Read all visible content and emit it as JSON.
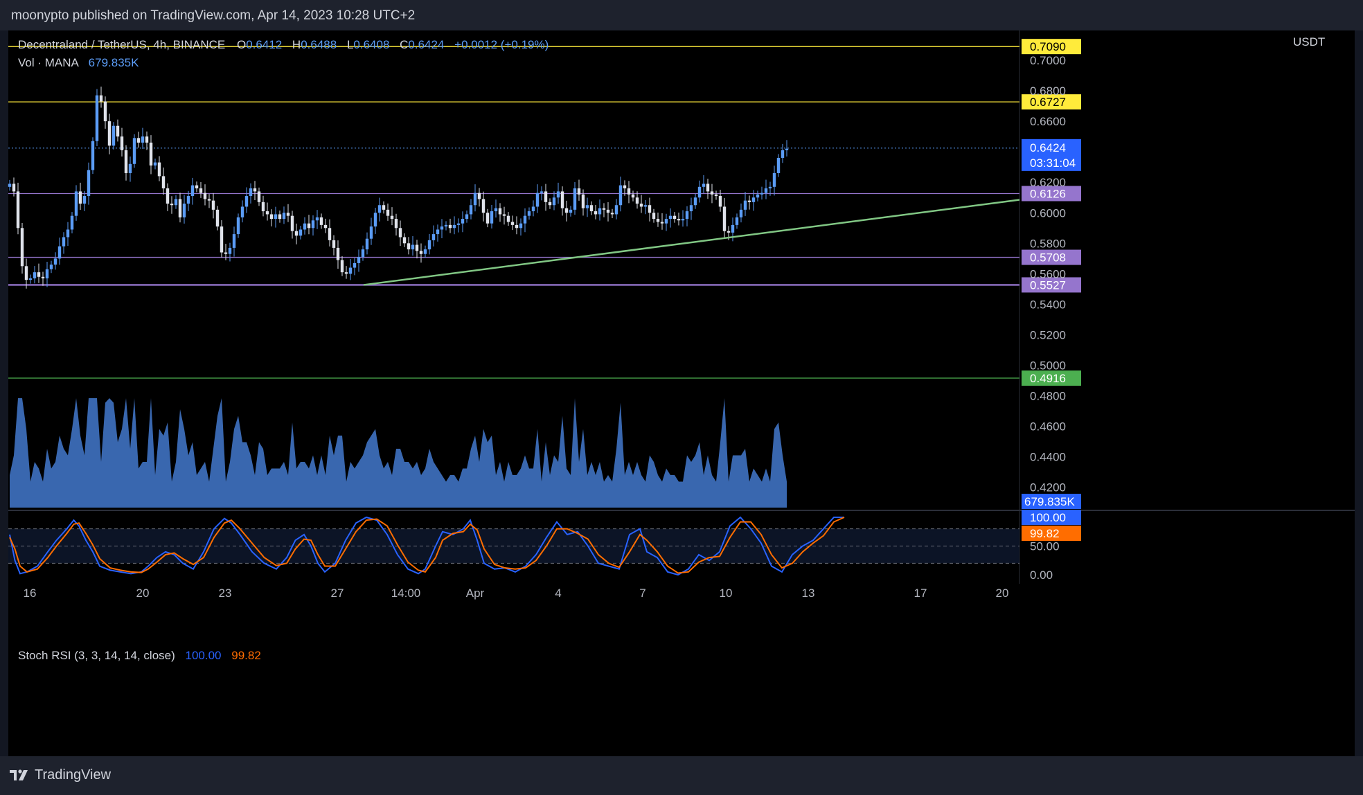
{
  "header": {
    "publish_line": "moonypto published on TradingView.com, Apr 14, 2023 10:28 UTC+2"
  },
  "legend": {
    "symbol": "Decentraland / TetherUS, 4h, BINANCE",
    "o_label": "O",
    "o": "0.6412",
    "h_label": "H",
    "h": "0.6488",
    "l_label": "L",
    "l": "0.6408",
    "c_label": "C",
    "c": "0.6424",
    "change": "+0.0012 (+0.19%)",
    "vol_label": "Vol · MANA",
    "vol_value": "679.835K",
    "stoch_label": "Stoch RSI (3, 3, 14, 14, close)",
    "stoch_k": "100.00",
    "stoch_d": "99.82"
  },
  "footer": {
    "brand": "TradingView"
  },
  "colors": {
    "up": "#5b9cf6",
    "down": "#e0e3eb",
    "yellow": "#ffeb3b",
    "purple": "#9575cd",
    "green": "#4caf50",
    "trend": "#81c784",
    "k": "#2962ff",
    "d": "#ff6d00"
  },
  "chart_data": [
    {
      "type": "candlestick",
      "title": "Decentraland / TetherUS, 4h, BINANCE",
      "y_unit": "USDT",
      "ylim": [
        0.408,
        0.712
      ],
      "y_ticks": [
        "0.7000",
        "0.6800",
        "0.6600",
        "0.6200",
        "0.6000",
        "0.5800",
        "0.5600",
        "0.5400",
        "0.5200",
        "0.5000",
        "0.4800",
        "0.4600",
        "0.4400",
        "0.4200"
      ],
      "x_ticks": [
        "16",
        "20",
        "23",
        "27",
        "14:00",
        "Apr",
        "4",
        "7",
        "10",
        "13",
        "17",
        "20"
      ],
      "last_price": "0.6424",
      "countdown": "03:31:04",
      "horizontal_lines": [
        {
          "value": 0.709,
          "label": "0.7090",
          "color": "#ffeb3b"
        },
        {
          "value": 0.6727,
          "label": "0.6727",
          "color": "#ffeb3b"
        },
        {
          "value": 0.6126,
          "label": "0.6126",
          "color": "#9575cd"
        },
        {
          "value": 0.5708,
          "label": "0.5708",
          "color": "#9575cd"
        },
        {
          "value": 0.5527,
          "label": "0.5527",
          "color": "#9575cd"
        },
        {
          "value": 0.4916,
          "label": "0.4916",
          "color": "#4caf50"
        }
      ],
      "trendline": {
        "from": [
          "Mar 28",
          0.5527
        ],
        "to": [
          "Apr 21",
          0.6085
        ]
      },
      "closes": [
        0.619,
        0.614,
        0.59,
        0.565,
        0.556,
        0.557,
        0.561,
        0.558,
        0.557,
        0.563,
        0.566,
        0.57,
        0.578,
        0.584,
        0.589,
        0.598,
        0.614,
        0.606,
        0.611,
        0.628,
        0.647,
        0.677,
        0.673,
        0.66,
        0.644,
        0.657,
        0.65,
        0.641,
        0.626,
        0.632,
        0.649,
        0.646,
        0.65,
        0.646,
        0.631,
        0.633,
        0.624,
        0.616,
        0.606,
        0.605,
        0.609,
        0.597,
        0.606,
        0.611,
        0.618,
        0.616,
        0.613,
        0.609,
        0.608,
        0.602,
        0.591,
        0.574,
        0.573,
        0.577,
        0.586,
        0.597,
        0.604,
        0.611,
        0.616,
        0.614,
        0.607,
        0.601,
        0.599,
        0.596,
        0.599,
        0.596,
        0.6,
        0.598,
        0.588,
        0.585,
        0.589,
        0.593,
        0.59,
        0.595,
        0.597,
        0.592,
        0.59,
        0.582,
        0.577,
        0.569,
        0.561,
        0.56,
        0.564,
        0.567,
        0.571,
        0.576,
        0.583,
        0.591,
        0.6,
        0.605,
        0.602,
        0.598,
        0.596,
        0.59,
        0.584,
        0.58,
        0.576,
        0.579,
        0.575,
        0.573,
        0.576,
        0.582,
        0.586,
        0.589,
        0.591,
        0.592,
        0.59,
        0.592,
        0.593,
        0.596,
        0.599,
        0.605,
        0.613,
        0.609,
        0.6,
        0.593,
        0.601,
        0.603,
        0.599,
        0.598,
        0.594,
        0.592,
        0.59,
        0.593,
        0.598,
        0.601,
        0.604,
        0.613,
        0.614,
        0.607,
        0.605,
        0.61,
        0.614,
        0.603,
        0.6,
        0.602,
        0.616,
        0.612,
        0.603,
        0.605,
        0.601,
        0.599,
        0.603,
        0.602,
        0.6,
        0.599,
        0.605,
        0.618,
        0.616,
        0.612,
        0.61,
        0.606,
        0.604,
        0.605,
        0.6,
        0.596,
        0.594,
        0.593,
        0.596,
        0.598,
        0.596,
        0.595,
        0.596,
        0.601,
        0.605,
        0.61,
        0.617,
        0.619,
        0.614,
        0.612,
        0.611,
        0.604,
        0.588,
        0.587,
        0.592,
        0.597,
        0.602,
        0.608,
        0.607,
        0.61,
        0.612,
        0.613,
        0.616,
        0.617,
        0.626,
        0.636,
        0.641,
        0.642
      ],
      "volume": {
        "last_value": "679.835K"
      }
    },
    {
      "type": "line",
      "title": "Stoch RSI (3, 3, 14, 14, close)",
      "ylim": [
        -6,
        106
      ],
      "y_ticks": [
        "50.00",
        "0.00"
      ],
      "bands": [
        20,
        80
      ],
      "series": [
        {
          "name": "K",
          "color": "#2962ff",
          "last": "100.00",
          "values": [
            [
              0,
              70
            ],
            [
              3,
              25
            ],
            [
              6,
              2
            ],
            [
              10,
              5
            ],
            [
              16,
              15
            ],
            [
              22,
              40
            ],
            [
              27,
              60
            ],
            [
              33,
              80
            ],
            [
              37,
              95
            ],
            [
              40,
              85
            ],
            [
              44,
              60
            ],
            [
              48,
              40
            ],
            [
              52,
              15
            ],
            [
              58,
              8
            ],
            [
              64,
              5
            ],
            [
              70,
              2
            ],
            [
              76,
              5
            ],
            [
              80,
              15
            ],
            [
              85,
              30
            ],
            [
              90,
              40
            ],
            [
              95,
              35
            ],
            [
              100,
              20
            ],
            [
              106,
              10
            ],
            [
              112,
              40
            ],
            [
              118,
              80
            ],
            [
              124,
              98
            ],
            [
              128,
              90
            ],
            [
              133,
              70
            ],
            [
              140,
              40
            ],
            [
              147,
              20
            ],
            [
              154,
              10
            ],
            [
              160,
              30
            ],
            [
              165,
              60
            ],
            [
              170,
              70
            ],
            [
              174,
              50
            ],
            [
              178,
              20
            ],
            [
              182,
              5
            ],
            [
              188,
              20
            ],
            [
              194,
              60
            ],
            [
              200,
              90
            ],
            [
              206,
              100
            ],
            [
              212,
              95
            ],
            [
              218,
              70
            ],
            [
              224,
              35
            ],
            [
              230,
              10
            ],
            [
              236,
              2
            ],
            [
              240,
              10
            ],
            [
              246,
              50
            ],
            [
              250,
              75
            ],
            [
              256,
              70
            ],
            [
              262,
              80
            ],
            [
              266,
              95
            ],
            [
              270,
              60
            ],
            [
              274,
              20
            ],
            [
              280,
              10
            ],
            [
              286,
              12
            ],
            [
              292,
              5
            ],
            [
              298,
              15
            ],
            [
              304,
              35
            ],
            [
              310,
              65
            ],
            [
              316,
              92
            ],
            [
              322,
              70
            ],
            [
              328,
              75
            ],
            [
              334,
              50
            ],
            [
              340,
              20
            ],
            [
              346,
              15
            ],
            [
              352,
              10
            ],
            [
              358,
              70
            ],
            [
              364,
              80
            ],
            [
              368,
              40
            ],
            [
              374,
              30
            ],
            [
              380,
              5
            ],
            [
              386,
              0
            ],
            [
              392,
              10
            ],
            [
              398,
              35
            ],
            [
              404,
              25
            ],
            [
              410,
              40
            ],
            [
              416,
              85
            ],
            [
              422,
              100
            ],
            [
              428,
              80
            ],
            [
              434,
              55
            ],
            [
              440,
              15
            ],
            [
              446,
              5
            ],
            [
              452,
              35
            ],
            [
              458,
              50
            ],
            [
              464,
              60
            ],
            [
              470,
              80
            ],
            [
              476,
              100
            ],
            [
              482,
              100
            ]
          ]
        },
        {
          "name": "D",
          "color": "#ff6d00",
          "last": "99.82",
          "values": [
            [
              0,
              65
            ],
            [
              3,
              45
            ],
            [
              6,
              15
            ],
            [
              10,
              5
            ],
            [
              16,
              10
            ],
            [
              22,
              30
            ],
            [
              27,
              50
            ],
            [
              33,
              72
            ],
            [
              37,
              88
            ],
            [
              40,
              90
            ],
            [
              44,
              72
            ],
            [
              48,
              52
            ],
            [
              52,
              28
            ],
            [
              58,
              12
            ],
            [
              64,
              8
            ],
            [
              70,
              5
            ],
            [
              76,
              4
            ],
            [
              80,
              10
            ],
            [
              85,
              22
            ],
            [
              90,
              35
            ],
            [
              95,
              38
            ],
            [
              100,
              28
            ],
            [
              106,
              18
            ],
            [
              112,
              30
            ],
            [
              118,
              65
            ],
            [
              124,
              90
            ],
            [
              128,
              95
            ],
            [
              133,
              80
            ],
            [
              140,
              55
            ],
            [
              147,
              30
            ],
            [
              154,
              16
            ],
            [
              160,
              20
            ],
            [
              165,
              45
            ],
            [
              170,
              62
            ],
            [
              174,
              60
            ],
            [
              178,
              35
            ],
            [
              182,
              15
            ],
            [
              188,
              15
            ],
            [
              194,
              45
            ],
            [
              200,
              75
            ],
            [
              206,
              95
            ],
            [
              212,
              97
            ],
            [
              218,
              85
            ],
            [
              224,
              52
            ],
            [
              230,
              22
            ],
            [
              236,
              8
            ],
            [
              240,
              5
            ],
            [
              246,
              30
            ],
            [
              250,
              60
            ],
            [
              256,
              72
            ],
            [
              262,
              75
            ],
            [
              266,
              88
            ],
            [
              270,
              78
            ],
            [
              274,
              45
            ],
            [
              280,
              18
            ],
            [
              286,
              12
            ],
            [
              292,
              10
            ],
            [
              298,
              12
            ],
            [
              304,
              25
            ],
            [
              310,
              50
            ],
            [
              316,
              80
            ],
            [
              322,
              80
            ],
            [
              328,
              72
            ],
            [
              334,
              62
            ],
            [
              340,
              35
            ],
            [
              346,
              20
            ],
            [
              352,
              13
            ],
            [
              358,
              40
            ],
            [
              364,
              70
            ],
            [
              368,
              60
            ],
            [
              374,
              40
            ],
            [
              380,
              15
            ],
            [
              386,
              3
            ],
            [
              392,
              5
            ],
            [
              398,
              22
            ],
            [
              404,
              30
            ],
            [
              410,
              32
            ],
            [
              416,
              65
            ],
            [
              422,
              92
            ],
            [
              428,
              92
            ],
            [
              434,
              70
            ],
            [
              440,
              35
            ],
            [
              446,
              12
            ],
            [
              452,
              20
            ],
            [
              458,
              40
            ],
            [
              464,
              55
            ],
            [
              470,
              68
            ],
            [
              476,
              92
            ],
            [
              482,
              100
            ]
          ]
        }
      ]
    }
  ]
}
